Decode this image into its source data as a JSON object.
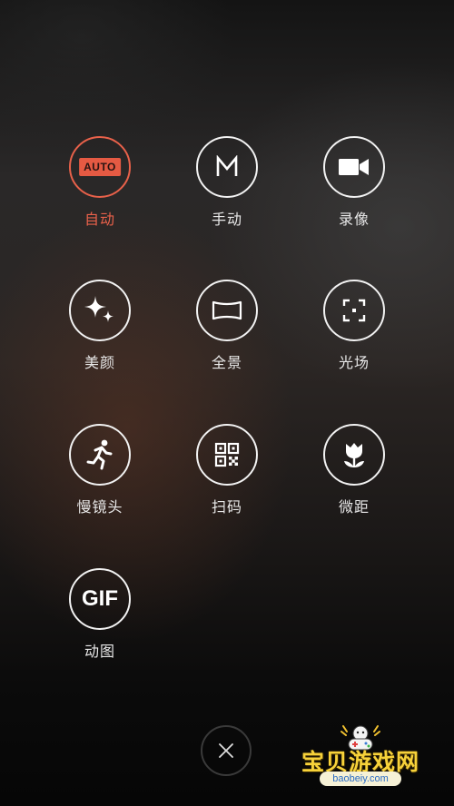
{
  "modes": {
    "auto": {
      "label": "自动",
      "badge": "AUTO"
    },
    "manual": {
      "label": "手动",
      "glyph": "M"
    },
    "video": {
      "label": "录像"
    },
    "beauty": {
      "label": "美颜"
    },
    "panorama": {
      "label": "全景"
    },
    "light_field": {
      "label": "光场"
    },
    "slow_motion": {
      "label": "慢镜头"
    },
    "scan": {
      "label": "扫码"
    },
    "macro": {
      "label": "微距"
    },
    "gif": {
      "label": "动图",
      "glyph": "GIF"
    }
  },
  "watermark": {
    "title": "宝贝游戏网",
    "url": "baobeiy.com"
  },
  "colors": {
    "accent": "#e8614a",
    "icon": "#ffffff",
    "watermark_yellow": "#f7d23a"
  },
  "icons": {
    "auto": "auto-icon",
    "manual": "manual-m-icon",
    "video": "video-camera-icon",
    "beauty": "sparkle-icon",
    "panorama": "panorama-icon",
    "light_field": "focus-frame-icon",
    "slow_motion": "running-person-icon",
    "scan": "qr-code-icon",
    "macro": "tulip-icon",
    "gif": "gif-icon",
    "close": "close-icon"
  }
}
